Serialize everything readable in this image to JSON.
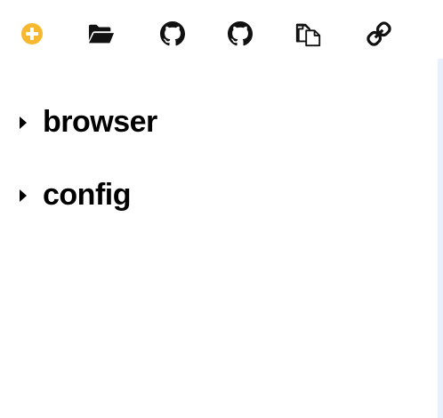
{
  "toolbar": {
    "buttons": [
      {
        "icon": "plus-circle-icon",
        "color": "#f5b82e"
      },
      {
        "icon": "folder-open-icon",
        "color": "#111111"
      },
      {
        "icon": "github-icon",
        "color": "#111111"
      },
      {
        "icon": "github-icon",
        "color": "#111111"
      },
      {
        "icon": "copy-icon",
        "color": "#111111"
      },
      {
        "icon": "link-icon",
        "color": "#111111"
      }
    ]
  },
  "tree": {
    "items": [
      {
        "label": "browser",
        "expanded": false
      },
      {
        "label": "config",
        "expanded": false
      }
    ]
  },
  "colors": {
    "accent": "#f5b82e",
    "side_strip": "#e8f1fb"
  }
}
